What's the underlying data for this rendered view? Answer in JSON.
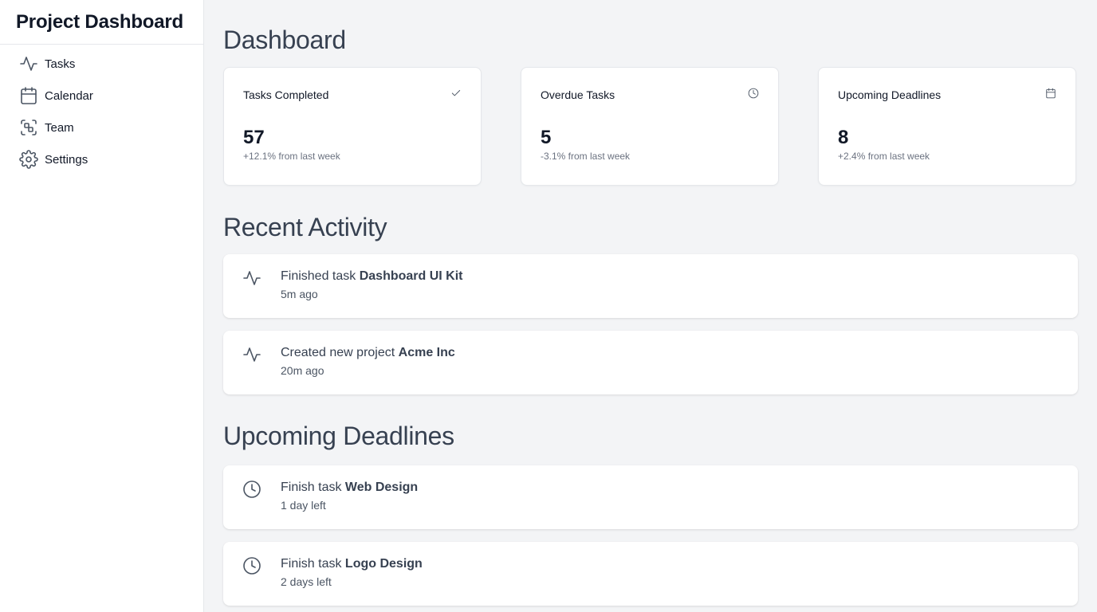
{
  "sidebar": {
    "title": "Project Dashboard",
    "items": [
      {
        "label": "Tasks",
        "icon": "activity-icon"
      },
      {
        "label": "Calendar",
        "icon": "calendar-icon"
      },
      {
        "label": "Team",
        "icon": "team-icon"
      },
      {
        "label": "Settings",
        "icon": "gear-icon"
      }
    ]
  },
  "dashboard": {
    "title": "Dashboard",
    "stats": [
      {
        "label": "Tasks Completed",
        "value": "57",
        "change": "+12.1% from last week",
        "icon": "check-icon"
      },
      {
        "label": "Overdue Tasks",
        "value": "5",
        "change": "-3.1% from last week",
        "icon": "clock-icon"
      },
      {
        "label": "Upcoming Deadlines",
        "value": "8",
        "change": "+2.4% from last week",
        "icon": "calendar-icon"
      }
    ]
  },
  "recent": {
    "title": "Recent Activity",
    "items": [
      {
        "prefix": "Finished task ",
        "bold": "Dashboard UI Kit",
        "time": "5m ago",
        "icon": "activity-icon"
      },
      {
        "prefix": "Created new project ",
        "bold": "Acme Inc",
        "time": "20m ago",
        "icon": "activity-icon"
      }
    ]
  },
  "deadlines": {
    "title": "Upcoming Deadlines",
    "items": [
      {
        "prefix": "Finish task ",
        "bold": "Web Design",
        "time": "1 day left",
        "icon": "clock-icon"
      },
      {
        "prefix": "Finish task ",
        "bold": "Logo Design",
        "time": "2 days left",
        "icon": "clock-icon"
      }
    ]
  }
}
